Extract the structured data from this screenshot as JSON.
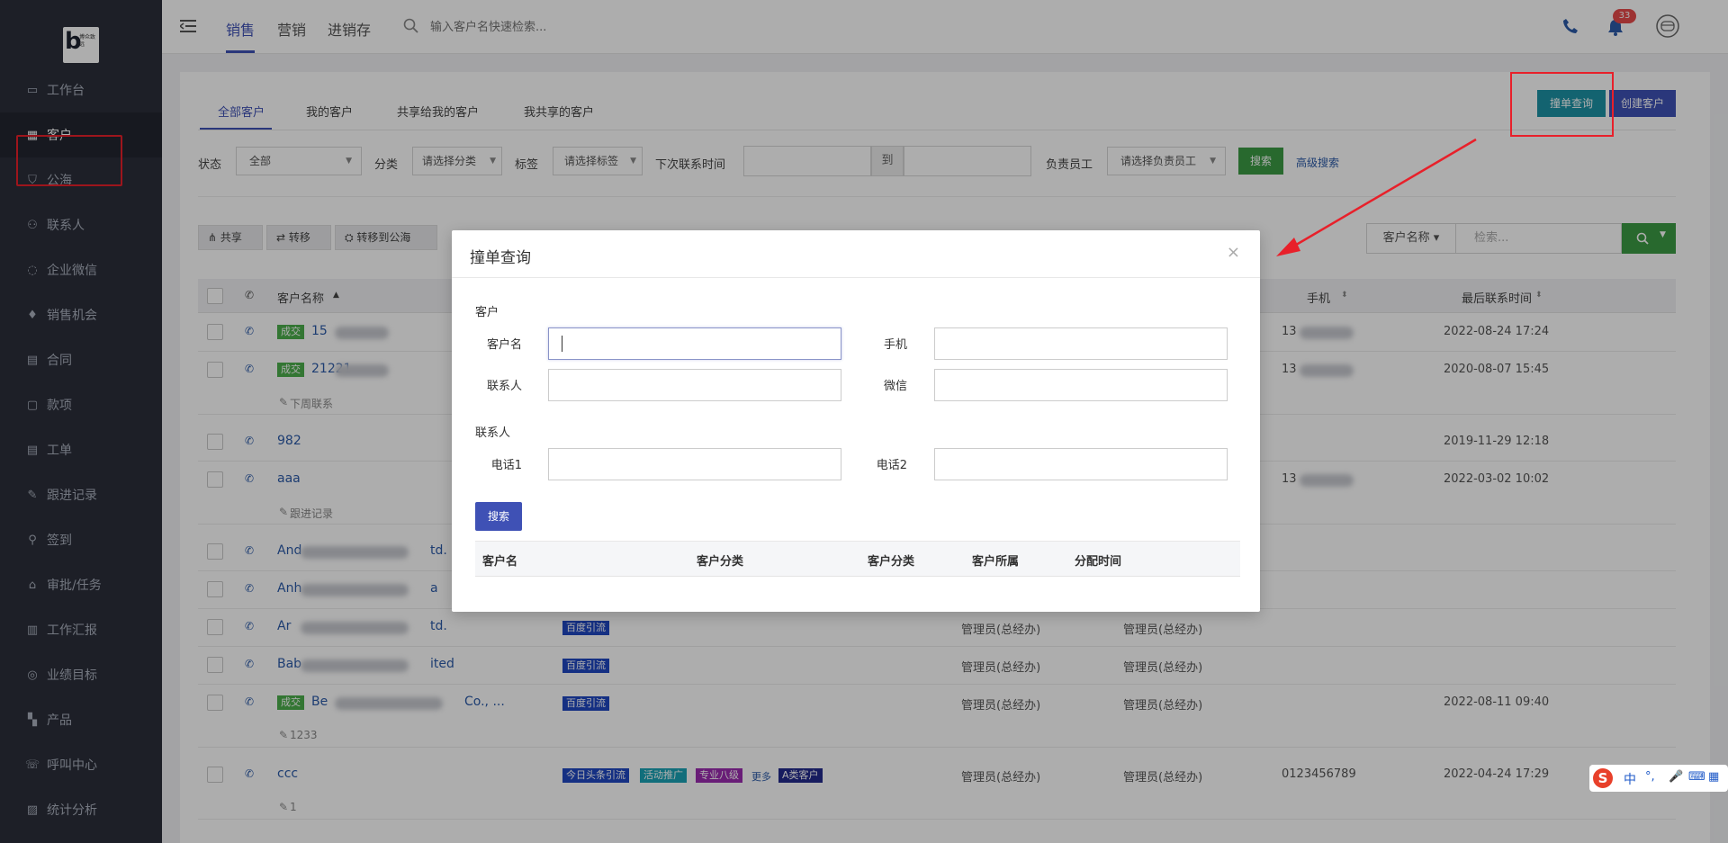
{
  "sidebar": {
    "logo_text": "博众致远",
    "items": [
      {
        "label": "工作台",
        "icon": "dashboard-icon"
      },
      {
        "label": "客户",
        "icon": "building-icon"
      },
      {
        "label": "公海",
        "icon": "basket-icon"
      },
      {
        "label": "联系人",
        "icon": "user-icon"
      },
      {
        "label": "企业微信",
        "icon": "chat-icon"
      },
      {
        "label": "销售机会",
        "icon": "money-bag-icon"
      },
      {
        "label": "合同",
        "icon": "contract-icon"
      },
      {
        "label": "款项",
        "icon": "payment-icon"
      },
      {
        "label": "工单",
        "icon": "ticket-icon"
      },
      {
        "label": "跟进记录",
        "icon": "edit-icon"
      },
      {
        "label": "签到",
        "icon": "location-icon"
      },
      {
        "label": "审批/任务",
        "icon": "approval-icon"
      },
      {
        "label": "工作汇报",
        "icon": "report-icon"
      },
      {
        "label": "业绩目标",
        "icon": "target-icon"
      },
      {
        "label": "产品",
        "icon": "grid-icon"
      },
      {
        "label": "呼叫中心",
        "icon": "headset-icon"
      },
      {
        "label": "统计分析",
        "icon": "chart-icon"
      }
    ]
  },
  "topbar": {
    "tabs": [
      "销售",
      "营销",
      "进销存"
    ],
    "search_placeholder": "输入客户名快速检索...",
    "notification_count": "33"
  },
  "content": {
    "tabs": [
      "全部客户",
      "我的客户",
      "共享给我的客户",
      "我共享的客户"
    ],
    "query_button": "撞单查询",
    "create_button": "创建客户",
    "filters": {
      "status_label": "状态",
      "status_value": "全部",
      "category_label": "分类",
      "category_value": "请选择分类",
      "tag_label": "标签",
      "tag_value": "请选择标签",
      "next_contact_label": "下次联系时间",
      "to_label": "到",
      "owner_label": "负责员工",
      "owner_value": "请选择负责员工",
      "search_button": "搜索",
      "advanced_search": "高级搜索"
    },
    "actions": [
      "共享",
      "转移",
      "转移到公海"
    ],
    "search_field_select": "客户名称",
    "search_placeholder": "检索...",
    "table": {
      "headers": [
        "客户名称",
        "手机",
        "最后联系时间"
      ],
      "rows": [
        {
          "status": "成交",
          "name": "15",
          "phone": "13",
          "last_contact": "2022-08-24 17:24"
        },
        {
          "status": "成交",
          "name": "21221",
          "phone": "13",
          "last_contact": "2020-08-07 15:45",
          "note": "下周联系"
        },
        {
          "name": "982",
          "last_contact": "2019-11-29 12:18"
        },
        {
          "name": "aaa",
          "phone": "13",
          "last_contact": "2022-03-02 10:02",
          "note": "跟进记录"
        },
        {
          "name": "And",
          "name_end": "td."
        },
        {
          "name": "Anh",
          "name_end": "a"
        },
        {
          "name": "Ar",
          "name_end": "td.",
          "tags": [
            "百度引流"
          ],
          "owner": "管理员(总经办)",
          "creator": "管理员(总经办)"
        },
        {
          "name": "Bab",
          "name_end": "ited",
          "tags": [
            "百度引流"
          ],
          "owner": "管理员(总经办)",
          "creator": "管理员(总经办)"
        },
        {
          "status": "成交",
          "name": "Be",
          "name_end": "Co., ...",
          "tags": [
            "百度引流"
          ],
          "owner": "管理员(总经办)",
          "creator": "管理员(总经办)",
          "last_contact": "2022-08-11 09:40",
          "note": "1233"
        },
        {
          "name": "ccc",
          "tags": [
            "今日头条引流",
            "活动推广",
            "专业八级",
            "A类客户"
          ],
          "more": "更多",
          "owner": "管理员(总经办)",
          "creator": "管理员(总经办)",
          "phone": "0123456789",
          "last_contact": "2022-04-24 17:29",
          "note": "1"
        }
      ]
    }
  },
  "modal": {
    "title": "撞单查询",
    "close": "×",
    "section_customer": "客户",
    "customer_name_label": "客户名",
    "mobile_label": "手机",
    "contact_label": "联系人",
    "wechat_label": "微信",
    "section_contact": "联系人",
    "phone1_label": "电话1",
    "phone2_label": "电话2",
    "search_button": "搜索",
    "result_headers": [
      "客户名",
      "客户分类",
      "客户分类",
      "客户所属",
      "分配时间"
    ]
  },
  "ime": {
    "labels": [
      "中",
      "°,"
    ]
  },
  "colors": {
    "primary": "#3f51b5",
    "teal": "#1d93a5",
    "green": "#3b9b44",
    "sidebar": "#2b2f3a",
    "annotation": "#e8202a"
  }
}
